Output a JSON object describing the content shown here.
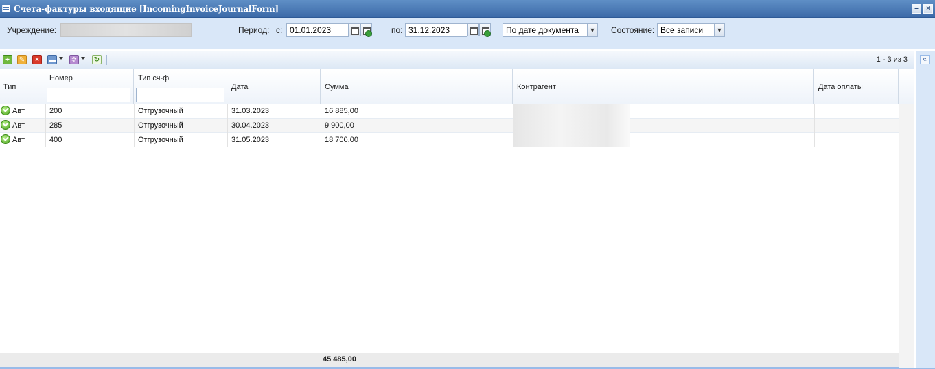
{
  "window": {
    "title": "Счета-фактуры входящие [IncomingInvoiceJournalForm]",
    "icons": [
      "grid-icon",
      "minimize-icon",
      "close-icon"
    ]
  },
  "filters": {
    "institution_label": "Учреждение:",
    "institution_value": "",
    "period_label": "Период:",
    "from_label": "с:",
    "from_value": "01.01.2023",
    "to_label": "по:",
    "to_value": "31.12.2023",
    "date_mode": "По дате документа",
    "state_label": "Состояние:",
    "state_value": "Все записи"
  },
  "toolbar": {
    "buttons": [
      "add-icon",
      "edit-icon",
      "delete-icon",
      "print-icon",
      "settings-icon",
      "refresh-icon"
    ],
    "pager": "1 - 3 из 3"
  },
  "grid": {
    "columns": [
      "Тип",
      "Номер",
      "Тип сч-ф",
      "Дата",
      "Сумма",
      "Контрагент",
      "Дата оплаты"
    ],
    "rows": [
      {
        "type": "Авт",
        "number": "200",
        "invoice_type": "Отгрузочный",
        "date": "31.03.2023",
        "amount": "16 885,00",
        "counterparty": "",
        "payment_date": ""
      },
      {
        "type": "Авт",
        "number": "285",
        "invoice_type": "Отгрузочный",
        "date": "30.04.2023",
        "amount": "9 900,00",
        "counterparty": "",
        "payment_date": ""
      },
      {
        "type": "Авт",
        "number": "400",
        "invoice_type": "Отгрузочный",
        "date": "31.05.2023",
        "amount": "18 700,00",
        "counterparty": "",
        "payment_date": ""
      }
    ],
    "total_amount": "45 485,00"
  },
  "colors": {
    "titlebar": "#4a7ab8",
    "filterbar": "#d9e7f8",
    "border": "#99bbe8",
    "status_ok": "#4aa21e"
  }
}
